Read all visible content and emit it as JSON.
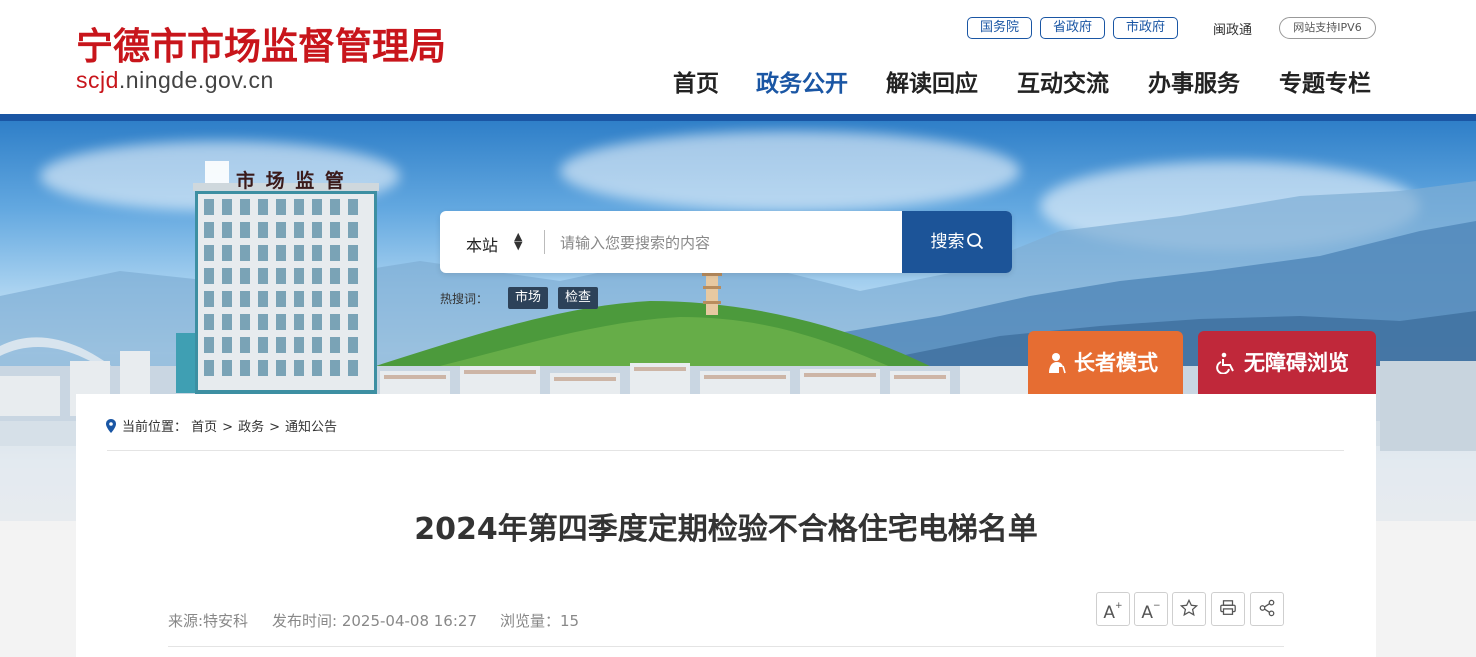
{
  "header": {
    "logo_cn": "宁德市市场监督管理局",
    "logo_url_red": "scjd",
    "logo_url_rest": ".ningde.gov.cn",
    "top_links": [
      "国务院",
      "省政府",
      "市政府"
    ],
    "min_zheng_tong": "闽政通",
    "ipv6_badge": "网站支持IPV6",
    "nav": [
      "首页",
      "政务公开",
      "解读回应",
      "互动交流",
      "办事服务",
      "专题专栏"
    ]
  },
  "banner": {
    "building_sign": "市 场 监 管"
  },
  "search": {
    "scope": "本站",
    "placeholder": "请输入您要搜索的内容",
    "button": "搜索",
    "hot_label": "热搜词：",
    "hot_words": [
      "市场",
      "检查"
    ]
  },
  "modes": {
    "elder": "长者模式",
    "accessible": "无障碍浏览"
  },
  "breadcrumb": {
    "label": "当前位置：",
    "items": [
      "首页",
      "政务",
      "通知公告"
    ]
  },
  "article": {
    "title": "2024年第四季度定期检验不合格住宅电梯名单",
    "source": "来源:特安科",
    "publish_time": "发布时间: 2025-04-08 16:27",
    "views": "浏览量：15"
  },
  "colors": {
    "brand_red": "#c8151b",
    "brand_blue": "#1a56a4",
    "elder_orange": "#e66d32",
    "access_red": "#c0283a"
  },
  "icons": {
    "pin": "location-pin-icon",
    "search": "search-icon",
    "font_up": "font-increase-icon",
    "font_down": "font-decrease-icon",
    "star": "star-icon",
    "print": "print-icon",
    "share": "share-icon"
  }
}
